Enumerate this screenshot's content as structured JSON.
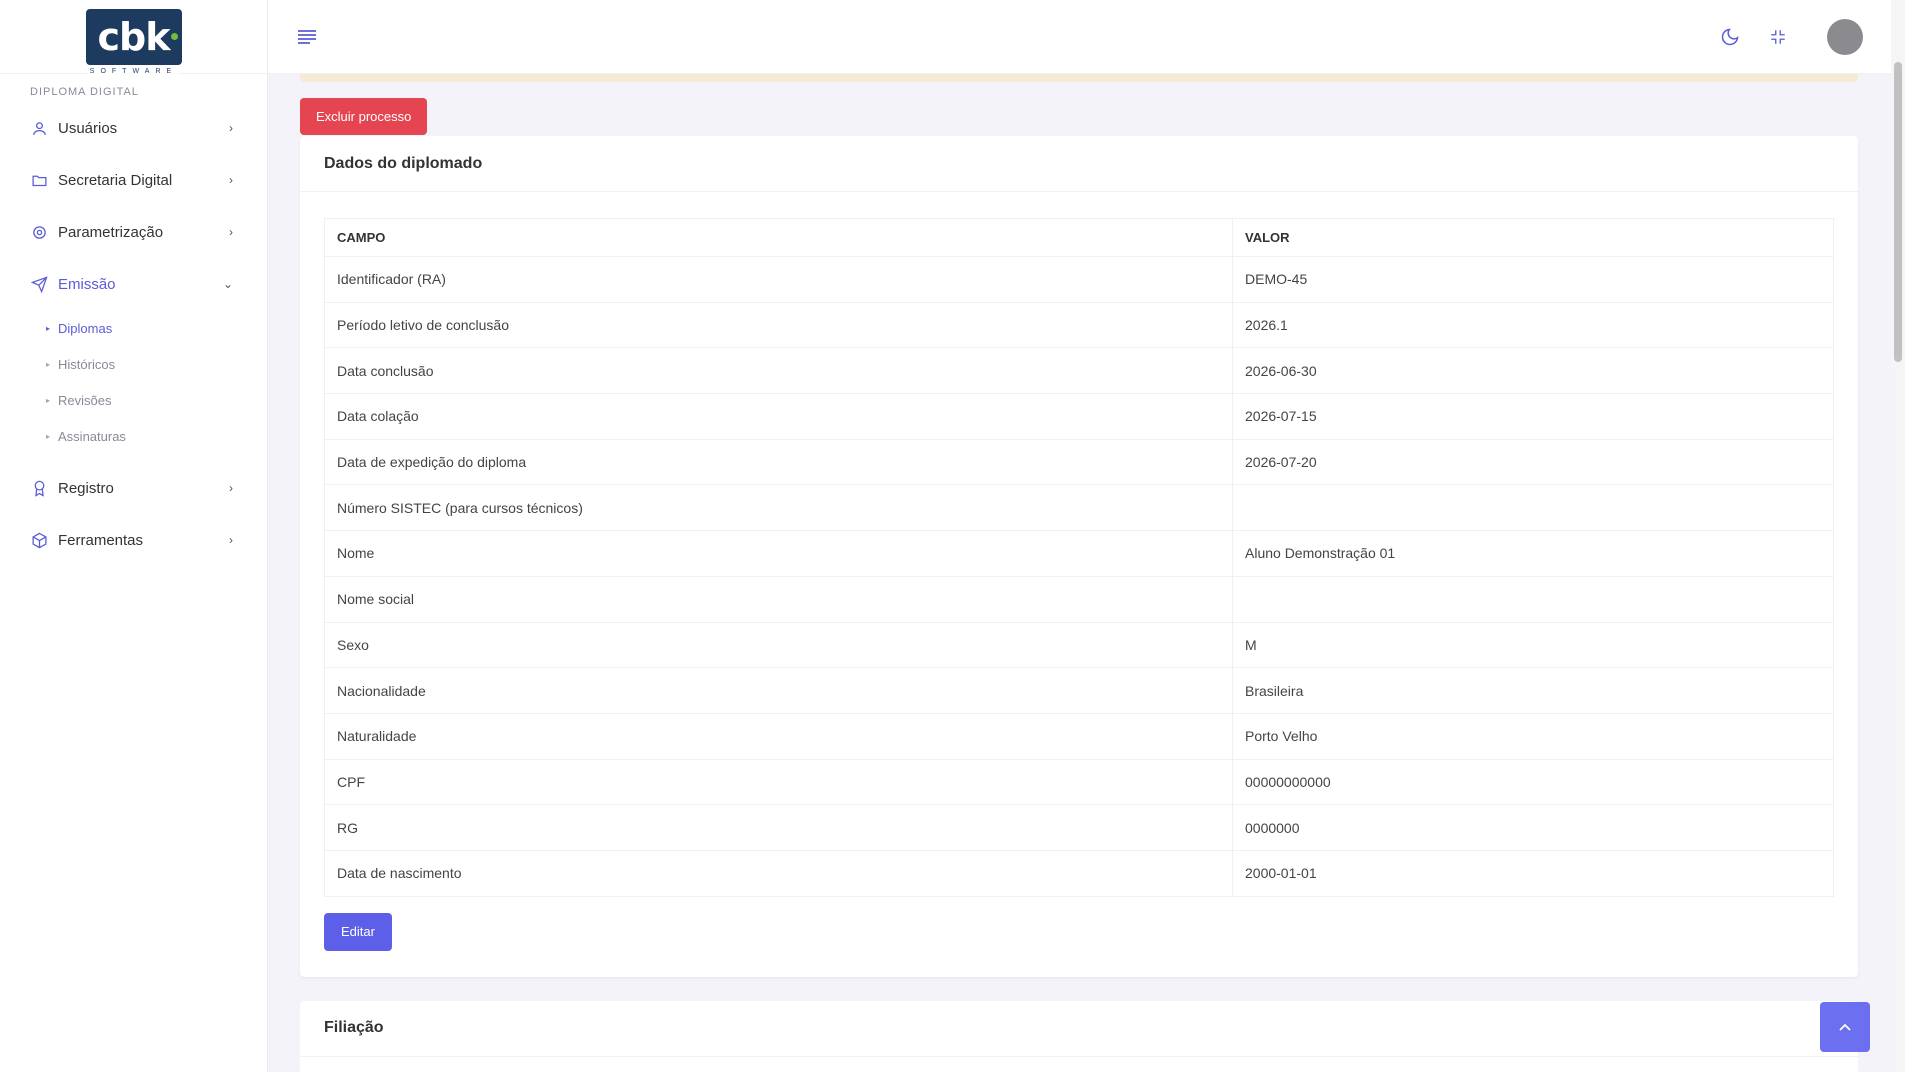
{
  "sidebar": {
    "logo_text": "cbk",
    "logo_sub": "SOFTWARE",
    "section_title": "DIPLOMA DIGITAL",
    "items": [
      {
        "label": "Usuários"
      },
      {
        "label": "Secretaria Digital"
      },
      {
        "label": "Parametrização"
      },
      {
        "label": "Emissão"
      },
      {
        "label": "Registro"
      },
      {
        "label": "Ferramentas"
      }
    ],
    "emissao_sub": [
      {
        "label": "Diplomas"
      },
      {
        "label": "Históricos"
      },
      {
        "label": "Revisões"
      },
      {
        "label": "Assinaturas"
      }
    ]
  },
  "actions": {
    "delete_label": "Excluir processo",
    "edit_label": "Editar"
  },
  "diplomado": {
    "title": "Dados do diplomado",
    "col_field": "CAMPO",
    "col_value": "VALOR",
    "rows": [
      {
        "field": "Identificador (RA)",
        "value": "DEMO-45"
      },
      {
        "field": "Período letivo de conclusão",
        "value": "2026.1"
      },
      {
        "field": "Data conclusão",
        "value": "2026-06-30"
      },
      {
        "field": "Data colação",
        "value": "2026-07-15"
      },
      {
        "field": "Data de expedição do diploma",
        "value": "2026-07-20"
      },
      {
        "field": "Número SISTEC (para cursos técnicos)",
        "value": ""
      },
      {
        "field": "Nome",
        "value": "Aluno Demonstração 01"
      },
      {
        "field": "Nome social",
        "value": ""
      },
      {
        "field": "Sexo",
        "value": "M"
      },
      {
        "field": "Nacionalidade",
        "value": "Brasileira"
      },
      {
        "field": "Naturalidade",
        "value": "Porto Velho"
      },
      {
        "field": "CPF",
        "value": "00000000000"
      },
      {
        "field": "RG",
        "value": "0000000"
      },
      {
        "field": "Data de nascimento",
        "value": "2000-01-01"
      }
    ]
  },
  "filiacao": {
    "title": "Filiação"
  },
  "colors": {
    "accent": "#5d5fe8",
    "danger": "#e54550",
    "logo_bg": "#1d3a5f"
  },
  "icons": [
    "menu-icon",
    "moon-icon",
    "minimize-icon",
    "user-icon",
    "folder-icon",
    "gear-icon",
    "send-icon",
    "award-icon",
    "box-icon",
    "chevron-up-icon"
  ]
}
